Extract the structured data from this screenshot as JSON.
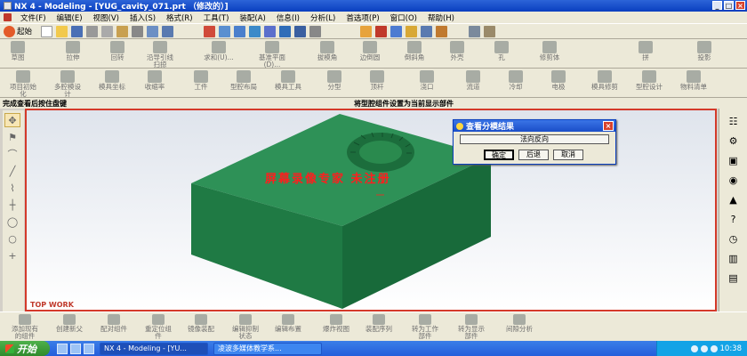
{
  "window": {
    "title": "NX 4 - Modeling - [YUG_cavity_071.prt （修改的）]"
  },
  "menu": [
    "文件(F)",
    "编辑(E)",
    "视图(V)",
    "插入(S)",
    "格式(R)",
    "工具(T)",
    "装配(A)",
    "信息(I)",
    "分析(L)",
    "首选项(P)",
    "窗口(O)",
    "帮助(H)"
  ],
  "toolbar": {
    "start_label": "起始"
  },
  "feature_toolbar": [
    "草图",
    "拉伸",
    "回转",
    "沿导引线\n扫掠",
    "求和(U)...",
    "基准平面\n(D)...",
    "拔模角",
    "边倒圆",
    "倒斜角",
    "外壳",
    "孔",
    "修剪体",
    "拼",
    "投影"
  ],
  "mold_toolbar": [
    "项目初始\n化",
    "多腔模设\n计",
    "模具坐标",
    "收缩率",
    "工件",
    "型腔布局",
    "模具工具",
    "分型",
    "顶杆",
    "浇口",
    "流道",
    "冷却",
    "电极",
    "模具修剪",
    "型腔设计",
    "物料清单"
  ],
  "status": {
    "left": "完成查看后按住盘键",
    "right": "将型腔组件设置为当前显示部件"
  },
  "viewport": {
    "label": "TOP WORK",
    "watermark": "屏幕录像专家 未注册",
    "bg_top": "#dfe4ec",
    "frame_color": "#d43a2a",
    "model_color": "#2a8a4e"
  },
  "dialog": {
    "title": "查看分模结果",
    "reverse_label": "法向反向",
    "ok_label": "确定",
    "back_label": "后退",
    "cancel_label": "取消"
  },
  "assembly_toolbar": [
    "添加现有\n的组件",
    "创建新父",
    "配对组件",
    "重定位组\n件",
    "镜像装配",
    "编辑抑制\n状态",
    "编辑布置",
    "爆炸视图",
    "装配序列",
    "转为工作\n部件",
    "转为显示\n部件",
    "间隙分析"
  ],
  "taskbar": {
    "start": "开始",
    "items": [
      "NX 4 - Modeling - [YU...",
      "凌波多媒体教学系..."
    ],
    "clock": "10:38"
  }
}
